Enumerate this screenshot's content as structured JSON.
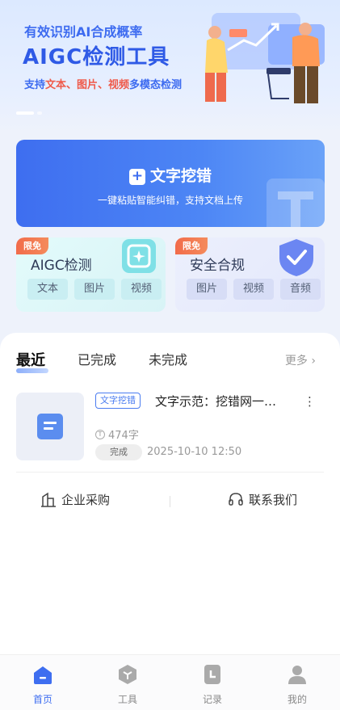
{
  "banner": {
    "line1": "有效识别AI合成概率",
    "line2": "AIGC检测工具",
    "line3_prefix": "支持",
    "line3_hl1": "文本、图片、视频",
    "line3_suffix": "多模态检测"
  },
  "main_card": {
    "title": "文字挖错",
    "plus": "+",
    "subtitle": "一键粘贴智能纠错，支持文档上传"
  },
  "aigc_card": {
    "tag": "限免",
    "title": "AIGC检测",
    "chips": [
      "文本",
      "图片",
      "视频"
    ]
  },
  "safety_card": {
    "tag": "限免",
    "title": "安全合规",
    "chips": [
      "图片",
      "视频",
      "音频"
    ]
  },
  "records": {
    "tabs": [
      "最近",
      "已完成",
      "未完成"
    ],
    "more": "更多",
    "item": {
      "tag": "文字挖错",
      "title": "文字示范：挖错网一…",
      "count": "474字",
      "status": "完成",
      "time": "2025-10-10 12:50"
    }
  },
  "links": {
    "enterprise": "企业采购",
    "contact": "联系我们"
  },
  "bottom_nav": [
    {
      "label": "首页",
      "icon": "home-icon"
    },
    {
      "label": "工具",
      "icon": "cube-icon"
    },
    {
      "label": "记录",
      "icon": "clock-icon"
    },
    {
      "label": "我的",
      "icon": "user-icon"
    }
  ],
  "colors": {
    "brand_blue": "#3e6ef0",
    "accent_red": "#ef5a4a",
    "tag_orange": "#f26b4a"
  }
}
